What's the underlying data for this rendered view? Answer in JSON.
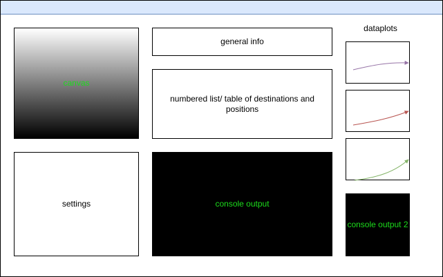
{
  "diagram": {
    "dataplots_title": "dataplots",
    "canvas_label": "canvas",
    "general_info_label": "general info",
    "list_label": "numbered list/ table of destinations and positions",
    "settings_label": "settings",
    "console_label": "console output",
    "console2_label": "console output 2",
    "plots": [
      {
        "color": "#9673a6"
      },
      {
        "color": "#b85450"
      },
      {
        "color": "#82b366"
      }
    ]
  },
  "colors": {
    "titlebar_fill": "#dae8fc",
    "titlebar_border": "#6c8ebf",
    "console_text": "#1cdc1c",
    "console_bg": "#000000"
  }
}
